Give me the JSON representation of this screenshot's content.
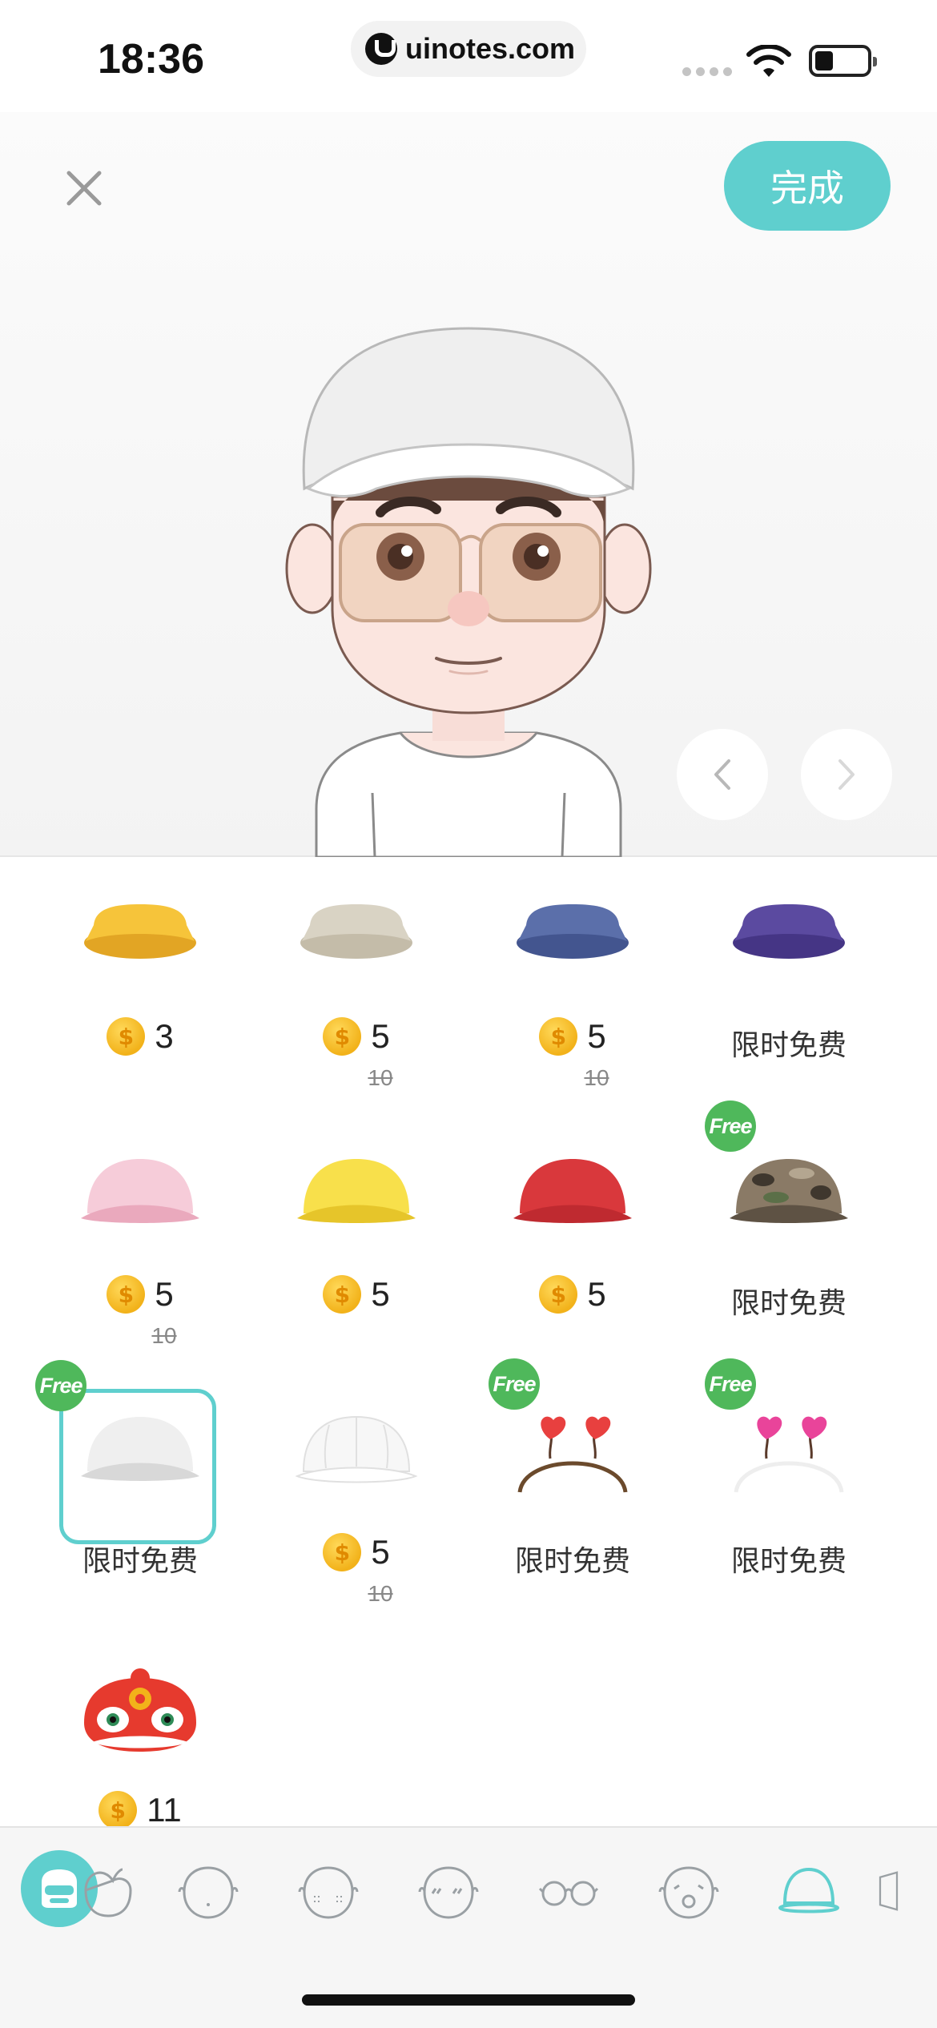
{
  "status_bar": {
    "time": "18:36",
    "url": "uinotes.com"
  },
  "header": {
    "done_label": "完成"
  },
  "items": [
    {
      "coin_price": "3",
      "old_price": "",
      "free_label": "",
      "free_badge": "",
      "hat": "cap",
      "colors": [
        "#f6c43a",
        "#e2a524"
      ]
    },
    {
      "coin_price": "5",
      "old_price": "10",
      "free_label": "",
      "free_badge": "",
      "hat": "cap",
      "colors": [
        "#d9d3c4",
        "#c4bca9"
      ]
    },
    {
      "coin_price": "5",
      "old_price": "10",
      "free_label": "",
      "free_badge": "",
      "hat": "cap",
      "colors": [
        "#5b6faa",
        "#43558f"
      ]
    },
    {
      "coin_price": "",
      "old_price": "",
      "free_label": "限时免费",
      "free_badge": "",
      "hat": "cap",
      "colors": [
        "#5b4aa0",
        "#453585"
      ]
    },
    {
      "coin_price": "5",
      "old_price": "10",
      "free_label": "",
      "free_badge": "",
      "hat": "dome",
      "colors": [
        "#f6ccd9",
        "#eaa9bd"
      ]
    },
    {
      "coin_price": "5",
      "old_price": "",
      "free_label": "",
      "free_badge": "",
      "hat": "dome",
      "colors": [
        "#f8e04b",
        "#e6c52a"
      ]
    },
    {
      "coin_price": "5",
      "old_price": "",
      "free_label": "",
      "free_badge": "",
      "hat": "dome",
      "colors": [
        "#d9383c",
        "#bf2a30"
      ]
    },
    {
      "coin_price": "",
      "old_price": "",
      "free_label": "限时免费",
      "free_badge": "Free",
      "hat": "camo",
      "colors": [
        "#8a7a66",
        "#5e5244"
      ]
    },
    {
      "coin_price": "",
      "old_price": "",
      "free_label": "限时免费",
      "free_badge": "Free",
      "hat": "dome",
      "colors": [
        "#efefef",
        "#d8d8d8"
      ],
      "selected": true
    },
    {
      "coin_price": "5",
      "old_price": "10",
      "free_label": "",
      "free_badge": "",
      "hat": "cap-outline",
      "colors": [
        "#f7f7f7",
        "#e0e0e0"
      ]
    },
    {
      "coin_price": "",
      "old_price": "",
      "free_label": "限时免费",
      "free_badge": "Free",
      "hat": "heart-band",
      "colors": [
        "#e8403f",
        "#6b4a2c"
      ]
    },
    {
      "coin_price": "",
      "old_price": "",
      "free_label": "限时免费",
      "free_badge": "Free",
      "hat": "heart-band",
      "colors": [
        "#e9449a",
        "#eeeeee"
      ]
    },
    {
      "coin_price": "11",
      "old_price": "",
      "free_label": "",
      "free_badge": "",
      "hat": "lion",
      "colors": [
        "#e63a2e",
        "#f2b21a"
      ]
    }
  ],
  "tabs": [
    {
      "name": "store-icon"
    },
    {
      "name": "face-shape-icon"
    },
    {
      "name": "face-icon"
    },
    {
      "name": "cheek-blush-icon"
    },
    {
      "name": "eyebrow-face-icon"
    },
    {
      "name": "glasses-icon"
    },
    {
      "name": "expression-icon"
    },
    {
      "name": "hat-icon"
    },
    {
      "name": "more-icon"
    }
  ],
  "accent_color": "#5fcfce"
}
